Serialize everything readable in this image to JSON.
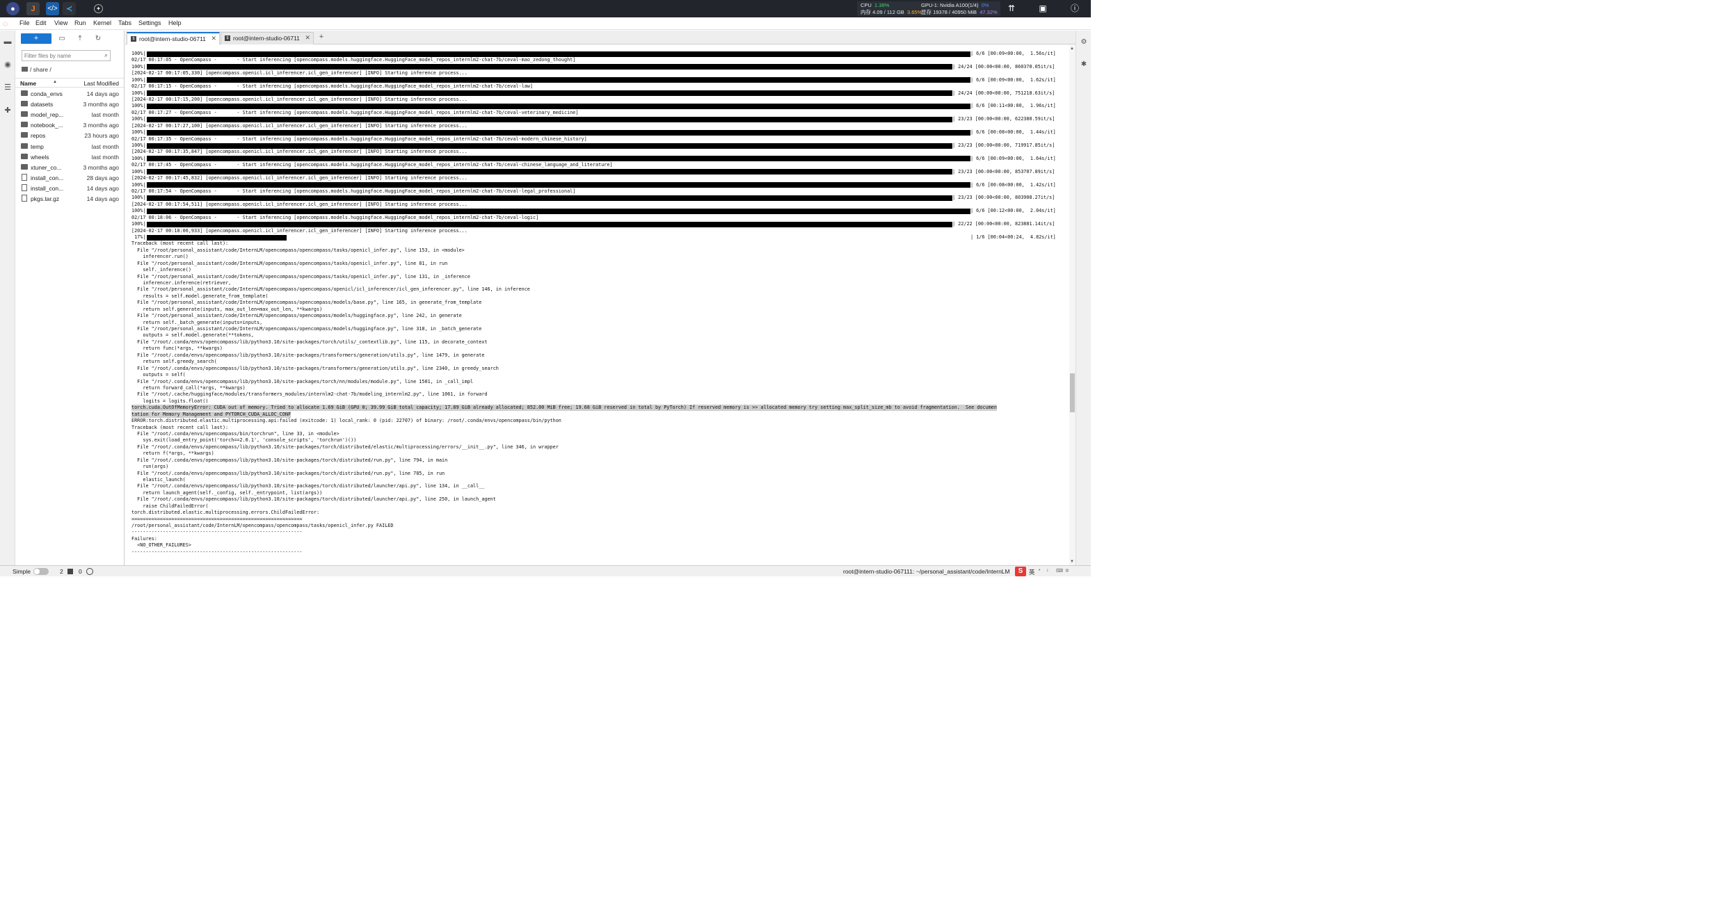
{
  "topbar": {
    "cpu_label": "CPU",
    "cpu_value": "1.38%",
    "mem_label": "内存 4.09 / 112 GB",
    "mem_value": "3.65%",
    "gpu_label": "GPU-1: Nvidia A100(1/4)",
    "gpu_value": "0%",
    "vram_label": "显存 19378 / 40950 MiB",
    "vram_value": "47.32%",
    "colors": {
      "cpu": "#3fd16d",
      "mem": "#ffb340",
      "gpu": "#4b8cff",
      "vram": "#b380ff"
    }
  },
  "menu": [
    "File",
    "Edit",
    "View",
    "Run",
    "Kernel",
    "Tabs",
    "Settings",
    "Help"
  ],
  "filebrowser": {
    "new_button": "+",
    "filter_placeholder": "Filter files by name",
    "breadcrumb": "/ share /",
    "col_name": "Name",
    "col_modified": "Last Modified",
    "files": [
      {
        "name": "conda_envs",
        "modified": "14 days ago",
        "type": "folder"
      },
      {
        "name": "datasets",
        "modified": "3 months ago",
        "type": "folder"
      },
      {
        "name": "model_rep...",
        "modified": "last month",
        "type": "folder"
      },
      {
        "name": "notebook_...",
        "modified": "3 months ago",
        "type": "folder"
      },
      {
        "name": "repos",
        "modified": "23 hours ago",
        "type": "folder"
      },
      {
        "name": "temp",
        "modified": "last month",
        "type": "folder"
      },
      {
        "name": "wheels",
        "modified": "last month",
        "type": "folder"
      },
      {
        "name": "xtuner_co...",
        "modified": "3 months ago",
        "type": "folder"
      },
      {
        "name": "install_con...",
        "modified": "28 days ago",
        "type": "file"
      },
      {
        "name": "install_con...",
        "modified": "14 days ago",
        "type": "file"
      },
      {
        "name": "pkgs.tar.gz",
        "modified": "14 days ago",
        "type": "file"
      }
    ]
  },
  "tabs": [
    {
      "label": "root@intern-studio-06711",
      "active": true
    },
    {
      "label": "root@intern-studio-06711",
      "active": false
    }
  ],
  "terminal": {
    "lines": [
      {
        "kind": "bar",
        "prefix": "100%|",
        "fill": 1.0,
        "stat": "| 6/6 [00:09<00:00,  1.56s/it]"
      },
      {
        "kind": "text",
        "text": "02/17 00:17:05 - OpenCompass -       - Start inferencing [opencompass.models.huggingface.HuggingFace_model_repos_internlm2-chat-7b/ceval-mao_zedong_thought]"
      },
      {
        "kind": "bar",
        "prefix": "100%|",
        "fill": 0.98,
        "stat": "| 24/24 [00:00<00:00, 860370.05it/s]"
      },
      {
        "kind": "text",
        "text": "[2024-02-17 00:17:05,330] [opencompass.openicl.icl_inferencer.icl_gen_inferencer] [INFO] Starting inference process..."
      },
      {
        "kind": "bar",
        "prefix": "100%|",
        "fill": 1.0,
        "stat": "| 6/6 [00:09<00:00,  1.62s/it]"
      },
      {
        "kind": "text",
        "text": "02/17 00:17:15 - OpenCompass -       - Start inferencing [opencompass.models.huggingface.HuggingFace_model_repos_internlm2-chat-7b/ceval-law]"
      },
      {
        "kind": "bar",
        "prefix": "100%|",
        "fill": 0.98,
        "stat": "| 24/24 [00:00<00:00, 751218.63it/s]"
      },
      {
        "kind": "text",
        "text": "[2024-02-17 00:17:15,200] [opencompass.openicl.icl_inferencer.icl_gen_inferencer] [INFO] Starting inference process..."
      },
      {
        "kind": "bar",
        "prefix": "100%|",
        "fill": 1.0,
        "stat": "| 6/6 [00:11<00:00,  1.96s/it]"
      },
      {
        "kind": "text",
        "text": "02/17 00:17:27 - OpenCompass -       - Start inferencing [opencompass.models.huggingface.HuggingFace_model_repos_internlm2-chat-7b/ceval-veterinary_medicine]"
      },
      {
        "kind": "bar",
        "prefix": "100%|",
        "fill": 0.98,
        "stat": "| 23/23 [00:00<00:00, 622380.59it/s]"
      },
      {
        "kind": "text",
        "text": "[2024-02-17 00:17:27,100] [opencompass.openicl.icl_inferencer.icl_gen_inferencer] [INFO] Starting inference process..."
      },
      {
        "kind": "bar",
        "prefix": "100%|",
        "fill": 1.0,
        "stat": "| 6/6 [00:08<00:00,  1.44s/it]"
      },
      {
        "kind": "text",
        "text": "02/17 00:17:35 - OpenCompass -       - Start inferencing [opencompass.models.huggingface.HuggingFace_model_repos_internlm2-chat-7b/ceval-modern_chinese_history]"
      },
      {
        "kind": "bar",
        "prefix": "100%|",
        "fill": 0.98,
        "stat": "| 23/23 [00:00<00:00, 719917.85it/s]"
      },
      {
        "kind": "text",
        "text": "[2024-02-17 00:17:35,847] [opencompass.openicl.icl_inferencer.icl_gen_inferencer] [INFO] Starting inference process..."
      },
      {
        "kind": "bar",
        "prefix": "100%|",
        "fill": 1.0,
        "stat": "| 6/6 [00:09<00:00,  1.64s/it]"
      },
      {
        "kind": "text",
        "text": "02/17 00:17:45 - OpenCompass -       - Start inferencing [opencompass.models.huggingface.HuggingFace_model_repos_internlm2-chat-7b/ceval-chinese_language_and_literature]"
      },
      {
        "kind": "bar",
        "prefix": "100%|",
        "fill": 0.98,
        "stat": "| 23/23 [00:00<00:00, 853707.89it/s]"
      },
      {
        "kind": "text",
        "text": "[2024-02-17 00:17:45,832] [opencompass.openicl.icl_inferencer.icl_gen_inferencer] [INFO] Starting inference process..."
      },
      {
        "kind": "bar",
        "prefix": "100%|",
        "fill": 1.0,
        "stat": "| 6/6 [00:08<00:00,  1.42s/it]"
      },
      {
        "kind": "text",
        "text": "02/17 00:17:54 - OpenCompass -       - Start inferencing [opencompass.models.huggingface.HuggingFace_model_repos_internlm2-chat-7b/ceval-legal_professional]"
      },
      {
        "kind": "bar",
        "prefix": "100%|",
        "fill": 0.98,
        "stat": "| 23/23 [00:00<00:00, 803908.27it/s]"
      },
      {
        "kind": "text",
        "text": "[2024-02-17 00:17:54,511] [opencompass.openicl.icl_inferencer.icl_gen_inferencer] [INFO] Starting inference process..."
      },
      {
        "kind": "bar",
        "prefix": "100%|",
        "fill": 1.0,
        "stat": "| 6/6 [00:12<00:00,  2.04s/it]"
      },
      {
        "kind": "text",
        "text": "02/17 00:18:06 - OpenCompass -       - Start inferencing [opencompass.models.huggingface.HuggingFace_model_repos_internlm2-chat-7b/ceval-logic]"
      },
      {
        "kind": "bar",
        "prefix": "100%|",
        "fill": 0.98,
        "stat": "| 22/22 [00:00<00:00, 823881.14it/s]"
      },
      {
        "kind": "text",
        "text": "[2024-02-17 00:18:06,933] [opencompass.openicl.icl_inferencer.icl_gen_inferencer] [INFO] Starting inference process..."
      },
      {
        "kind": "bar",
        "prefix": " 17%|",
        "fill": 0.17,
        "stat": "| 1/6 [00:04<00:24,  4.82s/it]"
      },
      {
        "kind": "text",
        "text": "Traceback (most recent call last):"
      },
      {
        "kind": "text",
        "text": "  File \"/root/personal_assistant/code/InternLM/opencompass/opencompass/tasks/openicl_infer.py\", line 153, in <module>"
      },
      {
        "kind": "text",
        "text": "    inferencer.run()"
      },
      {
        "kind": "text",
        "text": "  File \"/root/personal_assistant/code/InternLM/opencompass/opencompass/tasks/openicl_infer.py\", line 81, in run"
      },
      {
        "kind": "text",
        "text": "    self._inference()"
      },
      {
        "kind": "text",
        "text": "  File \"/root/personal_assistant/code/InternLM/opencompass/opencompass/tasks/openicl_infer.py\", line 131, in _inference"
      },
      {
        "kind": "text",
        "text": "    inferencer.inference(retriever,"
      },
      {
        "kind": "text",
        "text": "  File \"/root/personal_assistant/code/InternLM/opencompass/opencompass/openicl/icl_inferencer/icl_gen_inferencer.py\", line 146, in inference"
      },
      {
        "kind": "text",
        "text": "    results = self.model.generate_from_template("
      },
      {
        "kind": "text",
        "text": "  File \"/root/personal_assistant/code/InternLM/opencompass/opencompass/models/base.py\", line 165, in generate_from_template"
      },
      {
        "kind": "text",
        "text": "    return self.generate(inputs, max_out_len=max_out_len, **kwargs)"
      },
      {
        "kind": "text",
        "text": "  File \"/root/personal_assistant/code/InternLM/opencompass/opencompass/models/huggingface.py\", line 242, in generate"
      },
      {
        "kind": "text",
        "text": "    return self._batch_generate(inputs=inputs,"
      },
      {
        "kind": "text",
        "text": "  File \"/root/personal_assistant/code/InternLM/opencompass/opencompass/models/huggingface.py\", line 318, in _batch_generate"
      },
      {
        "kind": "text",
        "text": "    outputs = self.model.generate(**tokens,"
      },
      {
        "kind": "text",
        "text": "  File \"/root/.conda/envs/opencompass/lib/python3.10/site-packages/torch/utils/_contextlib.py\", line 115, in decorate_context"
      },
      {
        "kind": "text",
        "text": "    return func(*args, **kwargs)"
      },
      {
        "kind": "text",
        "text": "  File \"/root/.conda/envs/opencompass/lib/python3.10/site-packages/transformers/generation/utils.py\", line 1479, in generate"
      },
      {
        "kind": "text",
        "text": "    return self.greedy_search("
      },
      {
        "kind": "text",
        "text": "  File \"/root/.conda/envs/opencompass/lib/python3.10/site-packages/transformers/generation/utils.py\", line 2340, in greedy_search"
      },
      {
        "kind": "text",
        "text": "    outputs = self("
      },
      {
        "kind": "text",
        "text": "  File \"/root/.conda/envs/opencompass/lib/python3.10/site-packages/torch/nn/modules/module.py\", line 1501, in _call_impl"
      },
      {
        "kind": "text",
        "text": "    return forward_call(*args, **kwargs)"
      },
      {
        "kind": "text",
        "text": "  File \"/root/.cache/huggingface/modules/transformers_modules/internlm2-chat-7b/modeling_internlm2.py\", line 1061, in forward"
      },
      {
        "kind": "text",
        "text": "    logits = logits.float()"
      },
      {
        "kind": "hl",
        "text": "torch.cuda.OutOfMemoryError: CUDA out of memory. Tried to allocate 1.69 GiB (GPU 0; 39.99 GiB total capacity; 17.89 GiB already allocated; 852.00 MiB free; 19.68 GiB reserved in total by PyTorch) If reserved memory is >> allocated memory try setting max_split_size_mb to avoid fragmentation.  See documen"
      },
      {
        "kind": "hl",
        "text": "tation for Memory Management and PYTORCH_CUDA_ALLOC_CONF"
      },
      {
        "kind": "text",
        "text": "ERROR:torch.distributed.elastic.multiprocessing.api:failed (exitcode: 1) local_rank: 0 (pid: 22707) of binary: /root/.conda/envs/opencompass/bin/python"
      },
      {
        "kind": "text",
        "text": "Traceback (most recent call last):"
      },
      {
        "kind": "text",
        "text": "  File \"/root/.conda/envs/opencompass/bin/torchrun\", line 33, in <module>"
      },
      {
        "kind": "text",
        "text": "    sys.exit(load_entry_point('torch==2.0.1', 'console_scripts', 'torchrun')())"
      },
      {
        "kind": "text",
        "text": "  File \"/root/.conda/envs/opencompass/lib/python3.10/site-packages/torch/distributed/elastic/multiprocessing/errors/__init__.py\", line 346, in wrapper"
      },
      {
        "kind": "text",
        "text": "    return f(*args, **kwargs)"
      },
      {
        "kind": "text",
        "text": "  File \"/root/.conda/envs/opencompass/lib/python3.10/site-packages/torch/distributed/run.py\", line 794, in main"
      },
      {
        "kind": "text",
        "text": "    run(args)"
      },
      {
        "kind": "text",
        "text": "  File \"/root/.conda/envs/opencompass/lib/python3.10/site-packages/torch/distributed/run.py\", line 785, in run"
      },
      {
        "kind": "text",
        "text": "    elastic_launch("
      },
      {
        "kind": "text",
        "text": "  File \"/root/.conda/envs/opencompass/lib/python3.10/site-packages/torch/distributed/launcher/api.py\", line 134, in __call__"
      },
      {
        "kind": "text",
        "text": "    return launch_agent(self._config, self._entrypoint, list(args))"
      },
      {
        "kind": "text",
        "text": "  File \"/root/.conda/envs/opencompass/lib/python3.10/site-packages/torch/distributed/launcher/api.py\", line 250, in launch_agent"
      },
      {
        "kind": "text",
        "text": "    raise ChildFailedError("
      },
      {
        "kind": "text",
        "text": "torch.distributed.elastic.multiprocessing.errors.ChildFailedError:"
      },
      {
        "kind": "text",
        "text": "============================================================"
      },
      {
        "kind": "text",
        "text": "/root/personal_assistant/code/InternLM/opencompass/opencompass/tasks/openicl_infer.py FAILED"
      },
      {
        "kind": "text",
        "text": "------------------------------------------------------------"
      },
      {
        "kind": "text",
        "text": "Failures:"
      },
      {
        "kind": "text",
        "text": "  <NO_OTHER_FAILURES>"
      },
      {
        "kind": "text",
        "text": "------------------------------------------------------------"
      }
    ]
  },
  "statusbar": {
    "mode": "Simple",
    "terminals": "2",
    "kernels": "0",
    "path": "root@intern-studio-067111: ~/personal_assistant/code/InternLM",
    "ime": "S",
    "ime_lang": "英"
  }
}
